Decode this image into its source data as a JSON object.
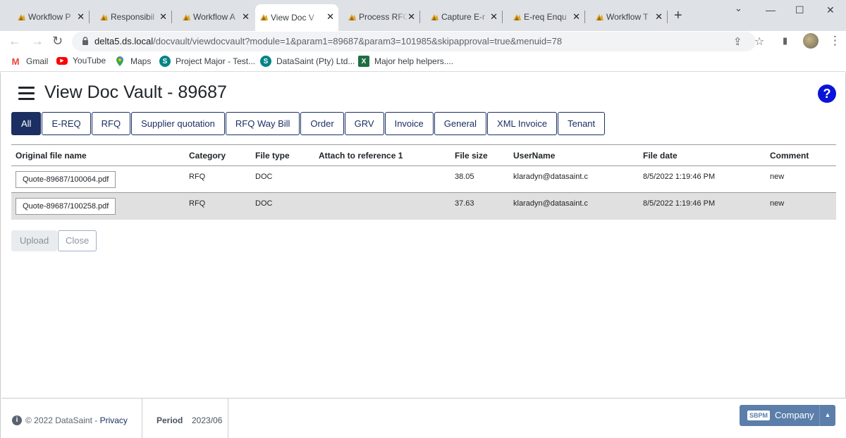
{
  "browser": {
    "tabs": [
      {
        "title": "Workflow P",
        "active": false
      },
      {
        "title": "Responsibil",
        "active": false
      },
      {
        "title": "Workflow A",
        "active": false
      },
      {
        "title": "View Doc V",
        "active": true
      },
      {
        "title": "Process RFC",
        "active": false
      },
      {
        "title": "Capture E-r",
        "active": false
      },
      {
        "title": "E-req Enqu",
        "active": false
      },
      {
        "title": "Workflow T",
        "active": false
      }
    ],
    "close_glyph": "✕",
    "new_tab_glyph": "+",
    "window_controls": {
      "minimize": "—",
      "maximize": "☐",
      "close": "✕"
    },
    "nav": {
      "back": "←",
      "forward": "→",
      "reload": "↻"
    },
    "url": {
      "host": "delta5.ds.local",
      "path": "/docvault/viewdocvault?module=1&param1=89687&param3=101985&skipapproval=true&menuid=78"
    },
    "toolbar_icons": {
      "share": "⇪",
      "bookmark_star": "☆",
      "side_panel": "▮",
      "menu": "⋮"
    },
    "bookmarks": [
      {
        "label": "Gmail",
        "icon": "gmail-icon",
        "glyph": "M",
        "color": "#ea4335"
      },
      {
        "label": "YouTube",
        "icon": "youtube-icon",
        "glyph": "▶",
        "color": "#ff0000"
      },
      {
        "label": "Maps",
        "icon": "maps-icon",
        "glyph": "●",
        "color": "#34a853"
      },
      {
        "label": "Project Major - Test...",
        "icon": "sharepoint-icon",
        "glyph": "S",
        "color": "#038387"
      },
      {
        "label": "DataSaint (Pty) Ltd...",
        "icon": "sharepoint-icon",
        "glyph": "S",
        "color": "#038387"
      },
      {
        "label": "Major help helpers....",
        "icon": "excel-icon",
        "glyph": "X",
        "color": "#1d6f42"
      }
    ]
  },
  "page": {
    "title": "View Doc Vault - 89687",
    "help_label": "?",
    "doc_tabs": [
      "All",
      "E-REQ",
      "RFQ",
      "Supplier quotation",
      "RFQ Way Bill",
      "Order",
      "GRV",
      "Invoice",
      "General",
      "XML Invoice",
      "Tenant"
    ],
    "active_doc_tab": "All",
    "grid": {
      "columns": [
        "Original file name",
        "Category",
        "File type",
        "Attach to reference 1",
        "File size",
        "UserName",
        "File date",
        "Comment"
      ],
      "rows": [
        {
          "file": "Quote-89687/100064.pdf",
          "category": "RFQ",
          "type": "DOC",
          "reference": "",
          "size": "38.05",
          "user": "klaradyn@datasaint.c",
          "date": "8/5/2022 1:19:46 PM",
          "comment": "new"
        },
        {
          "file": "Quote-89687/100258.pdf",
          "category": "RFQ",
          "type": "DOC",
          "reference": "",
          "size": "37.63",
          "user": "klaradyn@datasaint.c",
          "date": "8/5/2022 1:19:46 PM",
          "comment": "new"
        }
      ]
    },
    "buttons": {
      "upload": "Upload",
      "close": "Close"
    }
  },
  "footer": {
    "info_glyph": "i",
    "copyright": "© 2022 DataSaint - ",
    "privacy": "Privacy",
    "period_label": "Period",
    "period_value": "2023/06",
    "company_badge": "SBPM",
    "company_label": "Company",
    "company_caret": "▲"
  }
}
